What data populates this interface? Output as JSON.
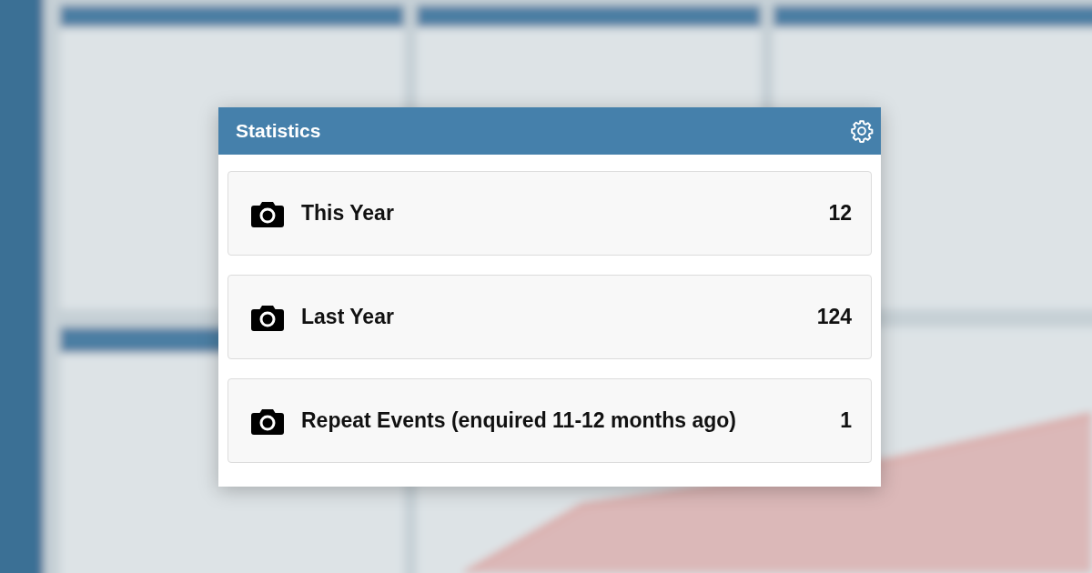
{
  "panel": {
    "title": "Statistics",
    "rows": [
      {
        "label": "This Year",
        "value": "12"
      },
      {
        "label": "Last Year",
        "value": "124"
      },
      {
        "label": "Repeat Events (enquired 11-12 months ago)",
        "value": "1"
      }
    ]
  }
}
